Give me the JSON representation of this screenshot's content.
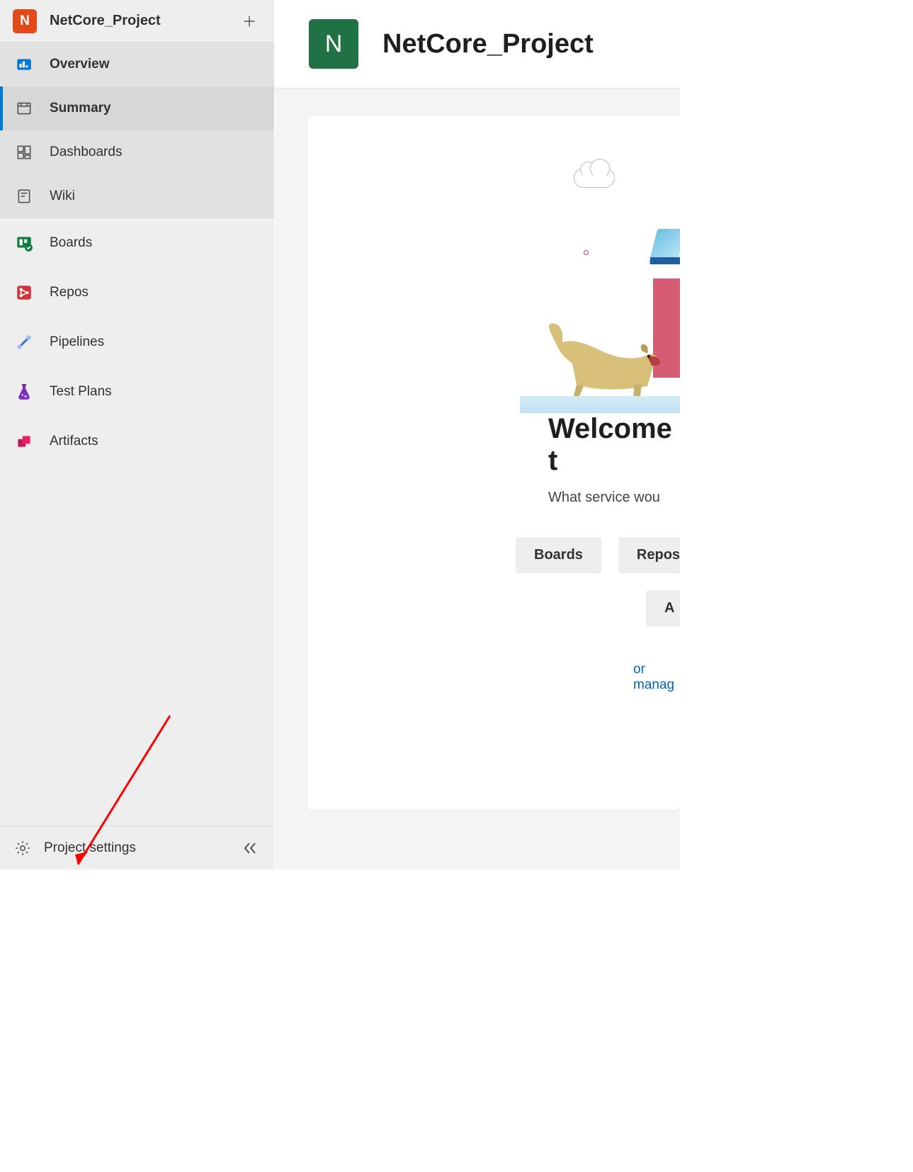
{
  "project": {
    "badge_letter": "N",
    "name": "NetCore_Project"
  },
  "sidebar": {
    "overview_section": {
      "label": "Overview",
      "items": [
        {
          "label": "Summary",
          "selected": true
        },
        {
          "label": "Dashboards",
          "selected": false
        },
        {
          "label": "Wiki",
          "selected": false
        }
      ]
    },
    "main_items": [
      {
        "label": "Boards"
      },
      {
        "label": "Repos"
      },
      {
        "label": "Pipelines"
      },
      {
        "label": "Test Plans"
      },
      {
        "label": "Artifacts"
      }
    ],
    "footer_label": "Project settings"
  },
  "main": {
    "title": "NetCore_Project",
    "welcome_title": "Welcome t",
    "welcome_sub": "What service wou",
    "buttons": [
      {
        "label": "Boards"
      },
      {
        "label": "Repos"
      }
    ],
    "button2": "A",
    "manage_link": "or manag"
  }
}
